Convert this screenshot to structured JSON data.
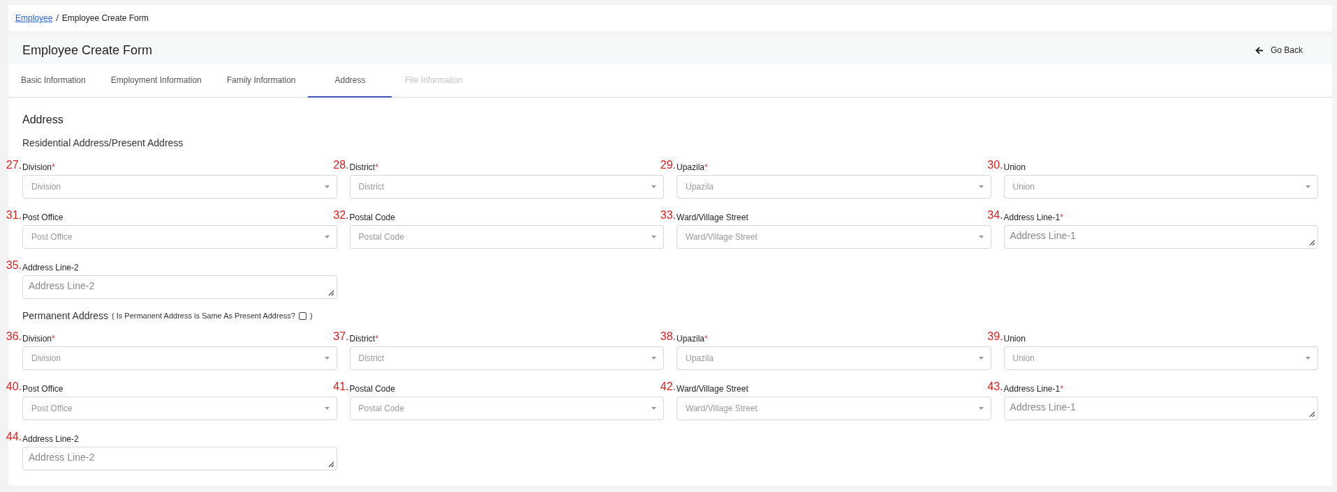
{
  "breadcrumb": {
    "items": [
      {
        "label": "Employee",
        "kind": "link"
      },
      {
        "label": "Employee Create Form",
        "kind": "current"
      }
    ],
    "separator": "/"
  },
  "header": {
    "title": "Employee Create Form",
    "back_button": "Go Back"
  },
  "tabs": [
    {
      "label": "Basic Information",
      "selected": false,
      "disabled": false
    },
    {
      "label": "Employment Information",
      "selected": false,
      "disabled": false
    },
    {
      "label": "Family Information",
      "selected": false,
      "disabled": false
    },
    {
      "label": "Address",
      "selected": true,
      "disabled": false
    },
    {
      "label": "File Information",
      "selected": false,
      "disabled": true
    }
  ],
  "section_title": "Address",
  "required_mark": "*",
  "groups": [
    {
      "title": "Residential Address/Present Address",
      "fields": [
        {
          "number": "27.",
          "label": "Division",
          "required": true,
          "kind": "select",
          "placeholder": "Division"
        },
        {
          "number": "28.",
          "label": "District",
          "required": true,
          "kind": "select",
          "placeholder": "District"
        },
        {
          "number": "29.",
          "label": "Upazila",
          "required": true,
          "kind": "select",
          "placeholder": "Upazila"
        },
        {
          "number": "30.",
          "label": "Union",
          "required": false,
          "kind": "select",
          "placeholder": "Union"
        },
        {
          "number": "31.",
          "label": "Post Office",
          "required": false,
          "kind": "select",
          "placeholder": "Post Office"
        },
        {
          "number": "32.",
          "label": "Postal Code",
          "required": false,
          "kind": "select",
          "placeholder": "Postal Code"
        },
        {
          "number": "33.",
          "label": "Ward/Village Street",
          "required": false,
          "kind": "select",
          "placeholder": "Ward/Village Street"
        },
        {
          "number": "34.",
          "label": "Address Line-1",
          "required": true,
          "kind": "textarea",
          "placeholder": "Address Line-1"
        },
        {
          "number": "35.",
          "label": "Address Line-2",
          "required": false,
          "kind": "textarea",
          "placeholder": "Address Line-2"
        }
      ]
    },
    {
      "title": "Permanent Address",
      "same_as_present": {
        "prefix": "( Is Permanent Address is Same As Present Address?",
        "checked": false,
        "suffix": ")"
      },
      "fields": [
        {
          "number": "36.",
          "label": "Division",
          "required": true,
          "kind": "select",
          "placeholder": "Division"
        },
        {
          "number": "37.",
          "label": "District",
          "required": true,
          "kind": "select",
          "placeholder": "District"
        },
        {
          "number": "38.",
          "label": "Upazila",
          "required": true,
          "kind": "select",
          "placeholder": "Upazila"
        },
        {
          "number": "39.",
          "label": "Union",
          "required": false,
          "kind": "select",
          "placeholder": "Union"
        },
        {
          "number": "40.",
          "label": "Post Office",
          "required": false,
          "kind": "select",
          "placeholder": "Post Office"
        },
        {
          "number": "41.",
          "label": "Postal Code",
          "required": false,
          "kind": "select",
          "placeholder": "Postal Code"
        },
        {
          "number": "42.",
          "label": "Ward/Village Street",
          "required": false,
          "kind": "select",
          "placeholder": "Ward/Village Street"
        },
        {
          "number": "43.",
          "label": "Address Line-1",
          "required": true,
          "kind": "textarea",
          "placeholder": "Address Line-1"
        },
        {
          "number": "44.",
          "label": "Address Line-2",
          "required": false,
          "kind": "textarea",
          "placeholder": "Address Line-2"
        }
      ]
    }
  ]
}
